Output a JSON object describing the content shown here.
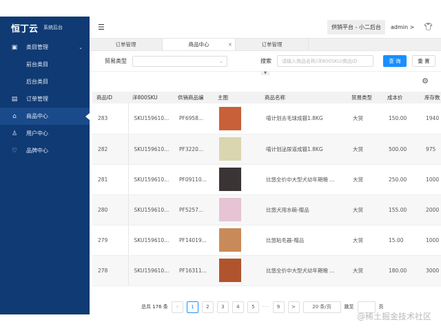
{
  "sidebar": {
    "brand": "恒丁云",
    "subtitle": "系统后台",
    "items": [
      {
        "label": "类目管理",
        "icon": "category-icon"
      },
      {
        "label": "前台类目"
      },
      {
        "label": "后台类目"
      },
      {
        "label": "订单管理",
        "icon": "order-icon"
      },
      {
        "label": "商品中心",
        "icon": "bag-icon"
      },
      {
        "label": "用户中心",
        "icon": "user-icon"
      },
      {
        "label": "品牌中心",
        "icon": "brand-icon"
      }
    ]
  },
  "header": {
    "platform": "供销平台 - 小二后台",
    "user": "admin",
    "user_arrow": ">"
  },
  "tabs": [
    {
      "label": "订单管理"
    },
    {
      "label": "商品中心",
      "close": "×"
    },
    {
      "label": "订单管理"
    }
  ],
  "filters": {
    "trade_type_label": "贸易类型",
    "search_label": "搜索",
    "search_placeholder": "请输入商品名称/洋800SKU/商品ID",
    "query": "查 询",
    "reset": "重 置"
  },
  "table": {
    "columns": [
      "商品ID",
      "洋800SKU",
      "供销商品编",
      "主图",
      "商品名称",
      "贸易类型",
      "成本价",
      "库存数"
    ],
    "rows": [
      {
        "id": "283",
        "sku": "SKU159610...",
        "code": "PF6958...",
        "name": "喵计划去毛球成猫1.8KG",
        "type": "大贸",
        "price": "150.00",
        "stock": "1940",
        "color": "#c8603a"
      },
      {
        "id": "282",
        "sku": "SKU159610...",
        "code": "PF3220...",
        "name": "喵计划泌尿道成猫1.8KG",
        "type": "大贸",
        "price": "500.00",
        "stock": "975",
        "color": "#d9d6b0"
      },
      {
        "id": "281",
        "sku": "SKU159610...",
        "code": "PF09110...",
        "name": "比悠全价中大型犬幼年期粮 ...",
        "type": "大贸",
        "price": "250.00",
        "stock": "1000",
        "color": "#3a3434"
      },
      {
        "id": "280",
        "sku": "SKU159610...",
        "code": "PF5257...",
        "name": "比悠犬用水碗-赠品",
        "type": "大贸",
        "price": "155.00",
        "stock": "2000",
        "color": "#e6c4d4"
      },
      {
        "id": "279",
        "sku": "SKU159610...",
        "code": "PF14019...",
        "name": "比悠粘毛器-赠品",
        "type": "大贸",
        "price": "15.00",
        "stock": "1000",
        "color": "#c98a5a"
      },
      {
        "id": "278",
        "sku": "SKU159610...",
        "code": "PF16311...",
        "name": "比悠全价中大型犬幼年期粮 ...",
        "type": "大贸",
        "price": "180.00",
        "stock": "3000",
        "color": "#b0542e"
      }
    ]
  },
  "pagination": {
    "total": "总共 176 条",
    "prev": "<",
    "pages": [
      "1",
      "2",
      "3",
      "4",
      "5"
    ],
    "ellipsis": "···",
    "last": "9",
    "next": ">",
    "page_size": "20 条/页",
    "jump_label": "跳至",
    "page_suffix": "页"
  },
  "watermark": "@稀土掘金技术社区"
}
